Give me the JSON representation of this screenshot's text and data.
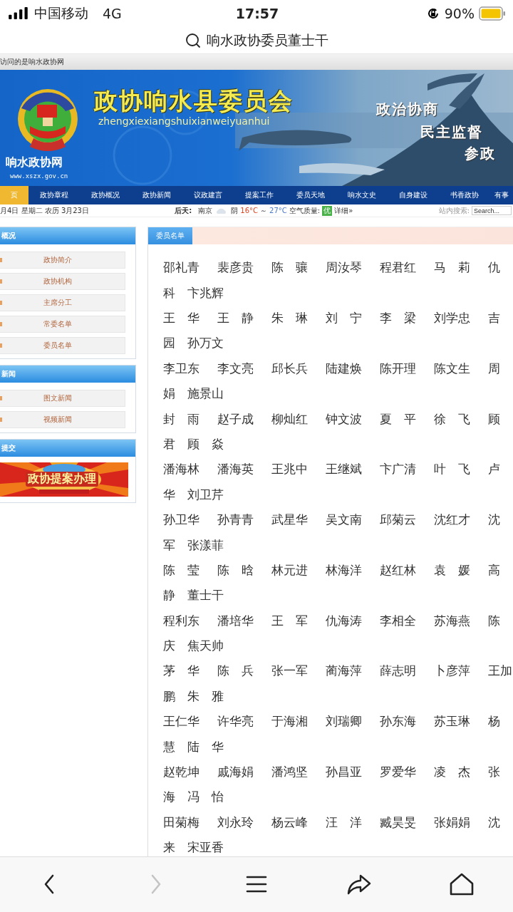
{
  "status_bar": {
    "carrier": "中国移动",
    "network": "4G",
    "time": "17:57",
    "battery": "90%"
  },
  "address_bar": {
    "query": "响水政协委员董士干"
  },
  "notice": "访问的是响水政协网",
  "banner": {
    "site_name": "响水政协网",
    "site_url": "www.xszx.gov.cn",
    "title": "政协响水县委员会",
    "pinyin": "zhengxiexiangshuixianweiyuanhui",
    "slogans": [
      "政治协商",
      "民主监督",
      "参政"
    ]
  },
  "nav": [
    {
      "label": "页",
      "selected": true
    },
    {
      "label": "政协章程",
      "selected": false
    },
    {
      "label": "政协概况",
      "selected": false
    },
    {
      "label": "政协新闻",
      "selected": false
    },
    {
      "label": "议政建言",
      "selected": false
    },
    {
      "label": "提案工作",
      "selected": false
    },
    {
      "label": "委员天地",
      "selected": false
    },
    {
      "label": "响水文史",
      "selected": false
    },
    {
      "label": "自身建设",
      "selected": false
    },
    {
      "label": "书香政协",
      "selected": false
    },
    {
      "label": "有事",
      "selected": false
    }
  ],
  "info_bar": {
    "date": "月4日 星期二 农历 3月23日",
    "forecast_label": "后天:",
    "city": "南京",
    "weather": "阴",
    "temp_low": "16°C",
    "range_sign": "～",
    "temp_high": "27°C",
    "air_label": "空气质量:",
    "air_quality": "优",
    "details_link": "详细»",
    "search_label": "站内搜索:",
    "search_placeholder": "Search..."
  },
  "sidebar": [
    {
      "title": "概况",
      "kind": "links",
      "items": [
        "政协简介",
        "政协机构",
        "主席分工",
        "常委名单",
        "委员名单"
      ]
    },
    {
      "title": "新闻",
      "kind": "links",
      "items": [
        "图文新闻",
        "视频新闻"
      ]
    },
    {
      "title": "提交",
      "kind": "banner",
      "banner_text": "政协提案办理"
    }
  ],
  "members": {
    "tab": "委员名单",
    "lines": [
      {
        "kind": "row",
        "names": [
          "邵礼青",
          "裴彦贵",
          "陈　骧",
          "周汝琴",
          "程君红",
          "马　莉",
          "仇"
        ]
      },
      {
        "kind": "wrap",
        "names": [
          "科",
          "卞兆辉"
        ]
      },
      {
        "kind": "row",
        "names": [
          "王　华",
          "王　静",
          "朱　琳",
          "刘　宁",
          "李　梁",
          "刘学忠",
          "吉"
        ]
      },
      {
        "kind": "wrap",
        "names": [
          "园",
          "孙万文"
        ]
      },
      {
        "kind": "row",
        "names": [
          "李卫东",
          "李文亮",
          "邱长兵",
          "陆建焕",
          "陈开理",
          "陈文生",
          "周"
        ]
      },
      {
        "kind": "wrap",
        "names": [
          "娟",
          "施景山"
        ]
      },
      {
        "kind": "row",
        "names": [
          "封　雨",
          "赵子成",
          "柳灿红",
          "钟文波",
          "夏　平",
          "徐　飞",
          "顾"
        ]
      },
      {
        "kind": "wrap",
        "names": [
          "君",
          "顾　焱"
        ]
      },
      {
        "kind": "row",
        "names": [
          "潘海林",
          "潘海英",
          "王兆中",
          "王继斌",
          "卞广清",
          "叶　飞",
          "卢"
        ]
      },
      {
        "kind": "wrap",
        "names": [
          "华",
          "刘卫芹"
        ]
      },
      {
        "kind": "row",
        "names": [
          "孙卫华",
          "孙青青",
          "武星华",
          "吴文南",
          "邱菊云",
          "沈红才",
          "沈"
        ]
      },
      {
        "kind": "wrap",
        "names": [
          "军",
          "张漾菲"
        ]
      },
      {
        "kind": "row",
        "names": [
          "陈　莹",
          "陈　晗",
          "林元进",
          "林海洋",
          "赵红林",
          "袁　媛",
          "高"
        ]
      },
      {
        "kind": "wrap",
        "names": [
          "静",
          "董士干"
        ]
      },
      {
        "kind": "row",
        "names": [
          "程利东",
          "潘培华",
          "王　军",
          "仇海涛",
          "李相全",
          "苏海燕",
          "陈"
        ]
      },
      {
        "kind": "wrap",
        "names": [
          "庆",
          "焦天帅"
        ]
      },
      {
        "kind": "row",
        "names": [
          "茅　华",
          "陈　兵",
          "张一军",
          "蔺海萍",
          "薛志明",
          "卜彦萍",
          "王加"
        ]
      },
      {
        "kind": "wrap",
        "names": [
          "鹏",
          "朱　雅"
        ]
      },
      {
        "kind": "row",
        "names": [
          "王仁华",
          "许华亮",
          "于海湘",
          "刘瑞卿",
          "孙东海",
          "苏玉琳",
          "杨"
        ]
      },
      {
        "kind": "wrap",
        "names": [
          "慧",
          "陆　华"
        ]
      },
      {
        "kind": "row",
        "names": [
          "赵乾坤",
          "戚海娟",
          "潘鸿坚",
          "孙昌亚",
          "罗爱华",
          "凌　杰",
          "张"
        ]
      },
      {
        "kind": "wrap",
        "names": [
          "海",
          "冯　怡"
        ]
      },
      {
        "kind": "row",
        "names": [
          "田菊梅",
          "刘永玲",
          "杨云峰",
          "汪　洋",
          "臧昊旻",
          "张娟娟",
          "沈"
        ]
      },
      {
        "kind": "wrap",
        "names": [
          "来",
          "宋亚香"
        ]
      }
    ]
  },
  "toolbar": [
    {
      "kind": "back",
      "disabled": false
    },
    {
      "kind": "forward",
      "disabled": true
    },
    {
      "kind": "menu",
      "disabled": false
    },
    {
      "kind": "share",
      "disabled": false
    },
    {
      "kind": "home",
      "disabled": false
    }
  ]
}
